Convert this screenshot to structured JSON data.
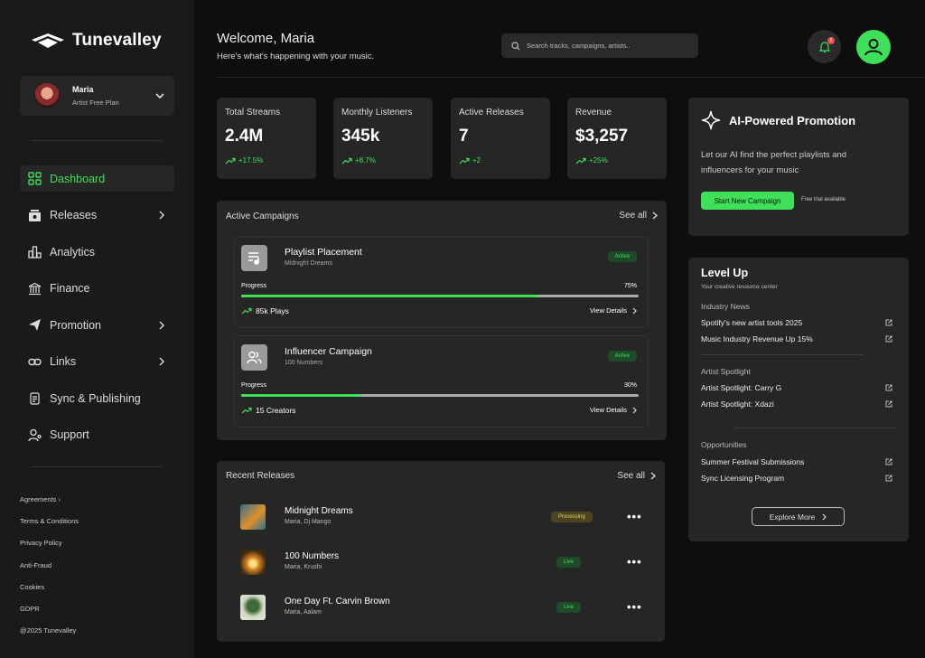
{
  "app": {
    "name": "Tunevalley"
  },
  "user": {
    "name": "Maria",
    "plan": "Artist Free Plan"
  },
  "nav": [
    {
      "label": "Dashboard",
      "icon": "grid-icon"
    },
    {
      "label": "Releases",
      "icon": "album-icon"
    },
    {
      "label": "Analytics",
      "icon": "bar-chart-icon"
    },
    {
      "label": "Finance",
      "icon": "bank-icon"
    },
    {
      "label": "Promotion",
      "icon": "send-icon"
    },
    {
      "label": "Links",
      "icon": "link-icon"
    },
    {
      "label": "Sync & Publishing",
      "icon": "document-icon"
    },
    {
      "label": "Support",
      "icon": "support-icon"
    }
  ],
  "footer_links": [
    "Agreements",
    "Terms & Conditions",
    "Privacy Policy",
    "Anti-Fraud",
    "Cookies",
    "GDPR",
    "@2025 Tunevalley"
  ],
  "header": {
    "welcome": "Welcome, Maria",
    "subtitle": "Here's what's happening with your music.",
    "search_placeholder": "Search tracks, campaigns, artists..",
    "notification_count": "1"
  },
  "stats": [
    {
      "label": "Total Streams",
      "value": "2.4M",
      "delta": "+17.5%"
    },
    {
      "label": "Monthly Listeners",
      "value": "345k",
      "delta": "+8.7%"
    },
    {
      "label": "Active Releases",
      "value": "7",
      "delta": "+2"
    },
    {
      "label": "Revenue",
      "value": "$3,257",
      "delta": "+25%"
    }
  ],
  "campaigns": {
    "title": "Active Campaigns",
    "see_all": "See all",
    "items": [
      {
        "title": "Playlist Placement",
        "subtitle": "Midnight Dreams",
        "status": "Active",
        "progress_label": "Progress",
        "progress_text": "75%",
        "progress": 0.75,
        "metric": "85k Plays",
        "details": "View Details",
        "icon": "playlist-icon"
      },
      {
        "title": "Influencer Campaign",
        "subtitle": "100 Numbers",
        "status": "Active",
        "progress_label": "Progress",
        "progress_text": "30%",
        "progress": 0.3,
        "metric": "15 Creators",
        "details": "View Details",
        "icon": "users-icon"
      }
    ]
  },
  "releases": {
    "title": "Recent Releases",
    "see_all": "See all",
    "items": [
      {
        "title": "Midnight Dreams",
        "artists": "Maria, Dj Mango",
        "status": "Processing"
      },
      {
        "title": "100 Numbers",
        "artists": "Maria, Krushi",
        "status": "Live"
      },
      {
        "title": "One Day Ft. Carvin Brown",
        "artists": "Maria, Aalam",
        "status": "Live"
      }
    ]
  },
  "ai_promo": {
    "title": "AI-Powered Promotion",
    "description": "Let our AI find the perfect playlists and influencers for your music",
    "button": "Start New Campaign",
    "note": "Free trial available"
  },
  "level_up": {
    "title": "Level Up",
    "subtitle": "Your creative resource center",
    "sections": [
      {
        "title": "Industry News",
        "links": [
          "Spotify's new artist tools 2025",
          "Music Industry Revenue Up 15%"
        ]
      },
      {
        "title": "Artist Spotlight",
        "links": [
          "Artist Spotlight: Carry G",
          "Artist Spotlight: Xdazi"
        ]
      },
      {
        "title": "Opportunities",
        "links": [
          "Summer Festival Submissions",
          "Sync Licensing Program"
        ]
      }
    ],
    "button": "Explore More"
  },
  "colors": {
    "accent": "#3ee05a",
    "panel": "#262626",
    "sidebar": "#1a1a1a",
    "background": "#0e0e0e"
  }
}
